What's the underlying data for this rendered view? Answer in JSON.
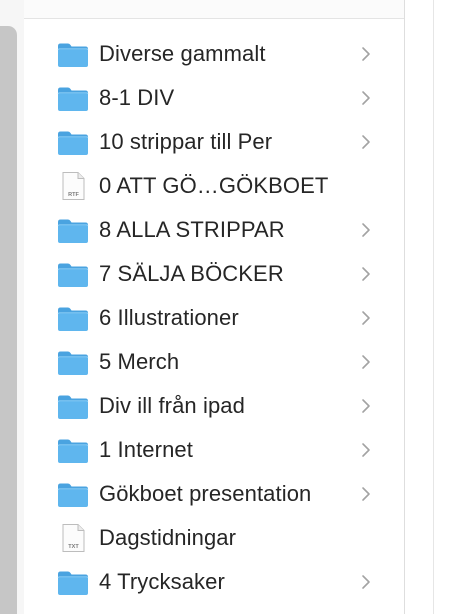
{
  "finder": {
    "items": [
      {
        "label": "Diverse gammalt",
        "kind": "folder",
        "has_children": true
      },
      {
        "label": "8-1 DIV",
        "kind": "folder",
        "has_children": true
      },
      {
        "label": "10 strippar till Per",
        "kind": "folder",
        "has_children": true
      },
      {
        "label": "0 ATT GÖ…GÖKBOET",
        "kind": "rtf-document",
        "badge": "RTF",
        "has_children": false
      },
      {
        "label": "8 ALLA STRIPPAR",
        "kind": "folder",
        "has_children": true
      },
      {
        "label": "7 SÄLJA BÖCKER",
        "kind": "folder",
        "has_children": true
      },
      {
        "label": "6 Illustrationer",
        "kind": "folder",
        "has_children": true
      },
      {
        "label": "5 Merch",
        "kind": "folder",
        "has_children": true
      },
      {
        "label": "Div ill från ipad",
        "kind": "folder",
        "has_children": true
      },
      {
        "label": "1 Internet",
        "kind": "folder",
        "has_children": true
      },
      {
        "label": "Gökboet presentation",
        "kind": "folder",
        "has_children": true
      },
      {
        "label": "Dagstidningar",
        "kind": "txt-document",
        "badge": "TXT",
        "has_children": false
      },
      {
        "label": "4 Trycksaker",
        "kind": "folder",
        "has_children": true
      }
    ]
  },
  "colors": {
    "folder_front": "#5fb6ee",
    "folder_back": "#4aa3e0",
    "text": "#262626",
    "chevron": "#a3a3a3"
  }
}
